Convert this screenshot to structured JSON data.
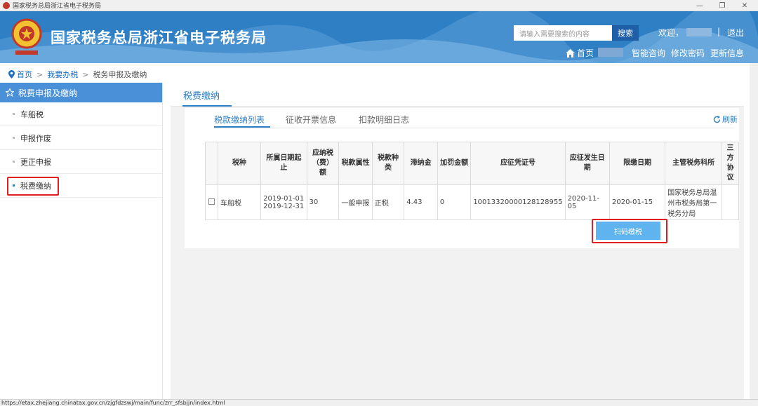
{
  "window": {
    "title": "国家税务总局浙江省电子税务局",
    "min": "—",
    "restore": "❐",
    "close": "✕"
  },
  "header": {
    "site_title": "国家税务总局浙江省电子税务局",
    "search_placeholder": "请输入需要搜索的内容",
    "search_button": "搜索",
    "welcome": "欢迎，",
    "separator": "|",
    "logout": "退出",
    "home": "首页",
    "links": [
      "智能咨询",
      "修改密码",
      "更新信息"
    ]
  },
  "breadcrumb": [
    "首页",
    "我要办税",
    "税务申报及缴纳"
  ],
  "sidebar": {
    "header": "税费申报及缴纳",
    "items": [
      "车船税",
      "申报作废",
      "更正申报",
      "税费缴纳"
    ]
  },
  "main": {
    "title": "税费缴纳",
    "tabs": [
      "税款缴纳列表",
      "征收开票信息",
      "扣款明细日志"
    ],
    "refresh": "刷新",
    "table": {
      "headers": [
        "",
        "税种",
        "所属日期起止",
        "应纳税（费）额",
        "税款属性",
        "税款种类",
        "滞纳金",
        "加罚金额",
        "应征凭证号",
        "应征发生日期",
        "限缴日期",
        "主管税务科所",
        "三方协议"
      ],
      "rows": [
        {
          "tax": "车船税",
          "period": "2019-01-01 2019-12-31",
          "amount": "30",
          "attr": "一般申报",
          "kind": "正税",
          "late_fee": "4.43",
          "penalty": "0",
          "voucher": "10013320000128128955",
          "occur_date": "2020-11-05",
          "deadline": "2020-01-15",
          "office": "国家税务总局温州市税务局第一税务分局",
          "tripartite": ""
        }
      ]
    },
    "pay_button": "扫码缴税"
  },
  "status_url": "https://etax.zhejiang.chinatax.gov.cn/zjgfdzswj/main/func/zrr_sfsbjjn/index.html"
}
